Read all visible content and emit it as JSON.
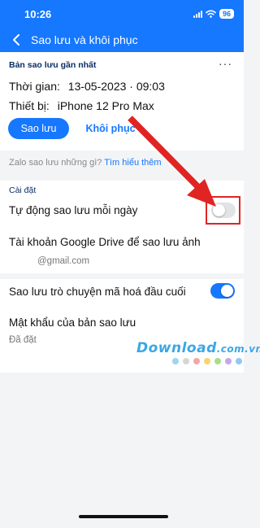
{
  "status_bar": {
    "time": "10:26",
    "battery": "96"
  },
  "header": {
    "title": "Sao lưu và khôi phục"
  },
  "backup": {
    "section_title": "Bản sao lưu gần nhất",
    "time_label": "Thời gian:",
    "time_value": "13-05-2023 · 09:03",
    "device_label": "Thiết bị:",
    "device_value": "iPhone 12 Pro Max",
    "backup_button": "Sao lưu",
    "restore_button": "Khôi phục"
  },
  "help": {
    "text": "Zalo sao lưu những gì?",
    "link": "Tìm hiểu thêm"
  },
  "settings": {
    "section_title": "Cài đặt",
    "auto_backup_label": "Tự động sao lưu mỗi ngày",
    "auto_backup_enabled": false,
    "drive_label": "Tài khoản Google Drive để sao lưu ảnh",
    "drive_value": "@gmail.com",
    "e2ee_label": "Sao lưu trò chuyện mã hoá đầu cuối",
    "e2ee_enabled": true,
    "password_label": "Mật khẩu của bản sao lưu",
    "password_value": "Đã đặt"
  },
  "watermark": {
    "text": "Download",
    "suffix": ".com.vn",
    "dot_colors": [
      "#9fd3f1",
      "#d6d6d6",
      "#f2a6a6",
      "#f5d66b",
      "#a6dd8f",
      "#c5a8e8",
      "#8fc8f5"
    ]
  },
  "annotation": {
    "color": "#e02424"
  }
}
